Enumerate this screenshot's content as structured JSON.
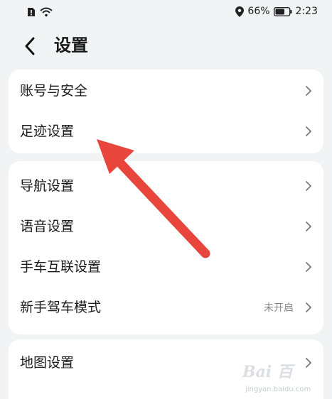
{
  "status_bar": {
    "battery_percent": "66%",
    "time": "2:23"
  },
  "header": {
    "title": "设置"
  },
  "groups": [
    {
      "items": [
        {
          "label": "账号与安全"
        },
        {
          "label": "足迹设置"
        }
      ]
    },
    {
      "items": [
        {
          "label": "导航设置"
        },
        {
          "label": "语音设置"
        },
        {
          "label": "手车互联设置"
        },
        {
          "label": "新手驾车模式",
          "value": "未开启"
        }
      ]
    },
    {
      "items": [
        {
          "label": "地图设置"
        }
      ]
    }
  ],
  "watermark": {
    "brand": "Bai 百",
    "url": "jingyan.baidu.com"
  },
  "colors": {
    "background": "#f1f3f5",
    "card": "#ffffff",
    "annotation_arrow": "#e8453c"
  }
}
